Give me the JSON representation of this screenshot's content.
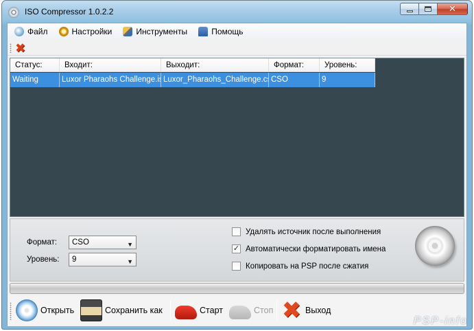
{
  "window": {
    "title": "ISO Compressor 1.0.2.2"
  },
  "menu": [
    {
      "label": "Файл",
      "icon": "file-icon"
    },
    {
      "label": "Настройки",
      "icon": "settings-icon"
    },
    {
      "label": "Инструменты",
      "icon": "tools-icon"
    },
    {
      "label": "Помощь",
      "icon": "help-icon"
    }
  ],
  "list": {
    "columns": [
      "Статус:",
      "Входит:",
      "Выходит:",
      "Формат:",
      "Уровень:"
    ],
    "rows": [
      [
        "Waiting",
        "Luxor Pharaohs Challenge.iso",
        "Luxor_Pharaohs_Challenge.cso",
        "CSO",
        "9"
      ]
    ]
  },
  "settings": {
    "format_label": "Формат:",
    "format_value": "CSO",
    "level_label": "Уровень:",
    "level_value": "9",
    "checkboxes": [
      {
        "label": "Удалять источник после выполнения",
        "checked": false
      },
      {
        "label": "Автоматически форматировать имена",
        "checked": true
      },
      {
        "label": "Копировать на PSP после сжатия",
        "checked": false
      }
    ]
  },
  "progress": {
    "value": 0
  },
  "bottom_toolbar": {
    "open": "Открыть",
    "save_as": "Сохранить как",
    "start": "Старт",
    "stop": "Стоп",
    "exit": "Выход"
  },
  "watermark": "PSP-info"
}
